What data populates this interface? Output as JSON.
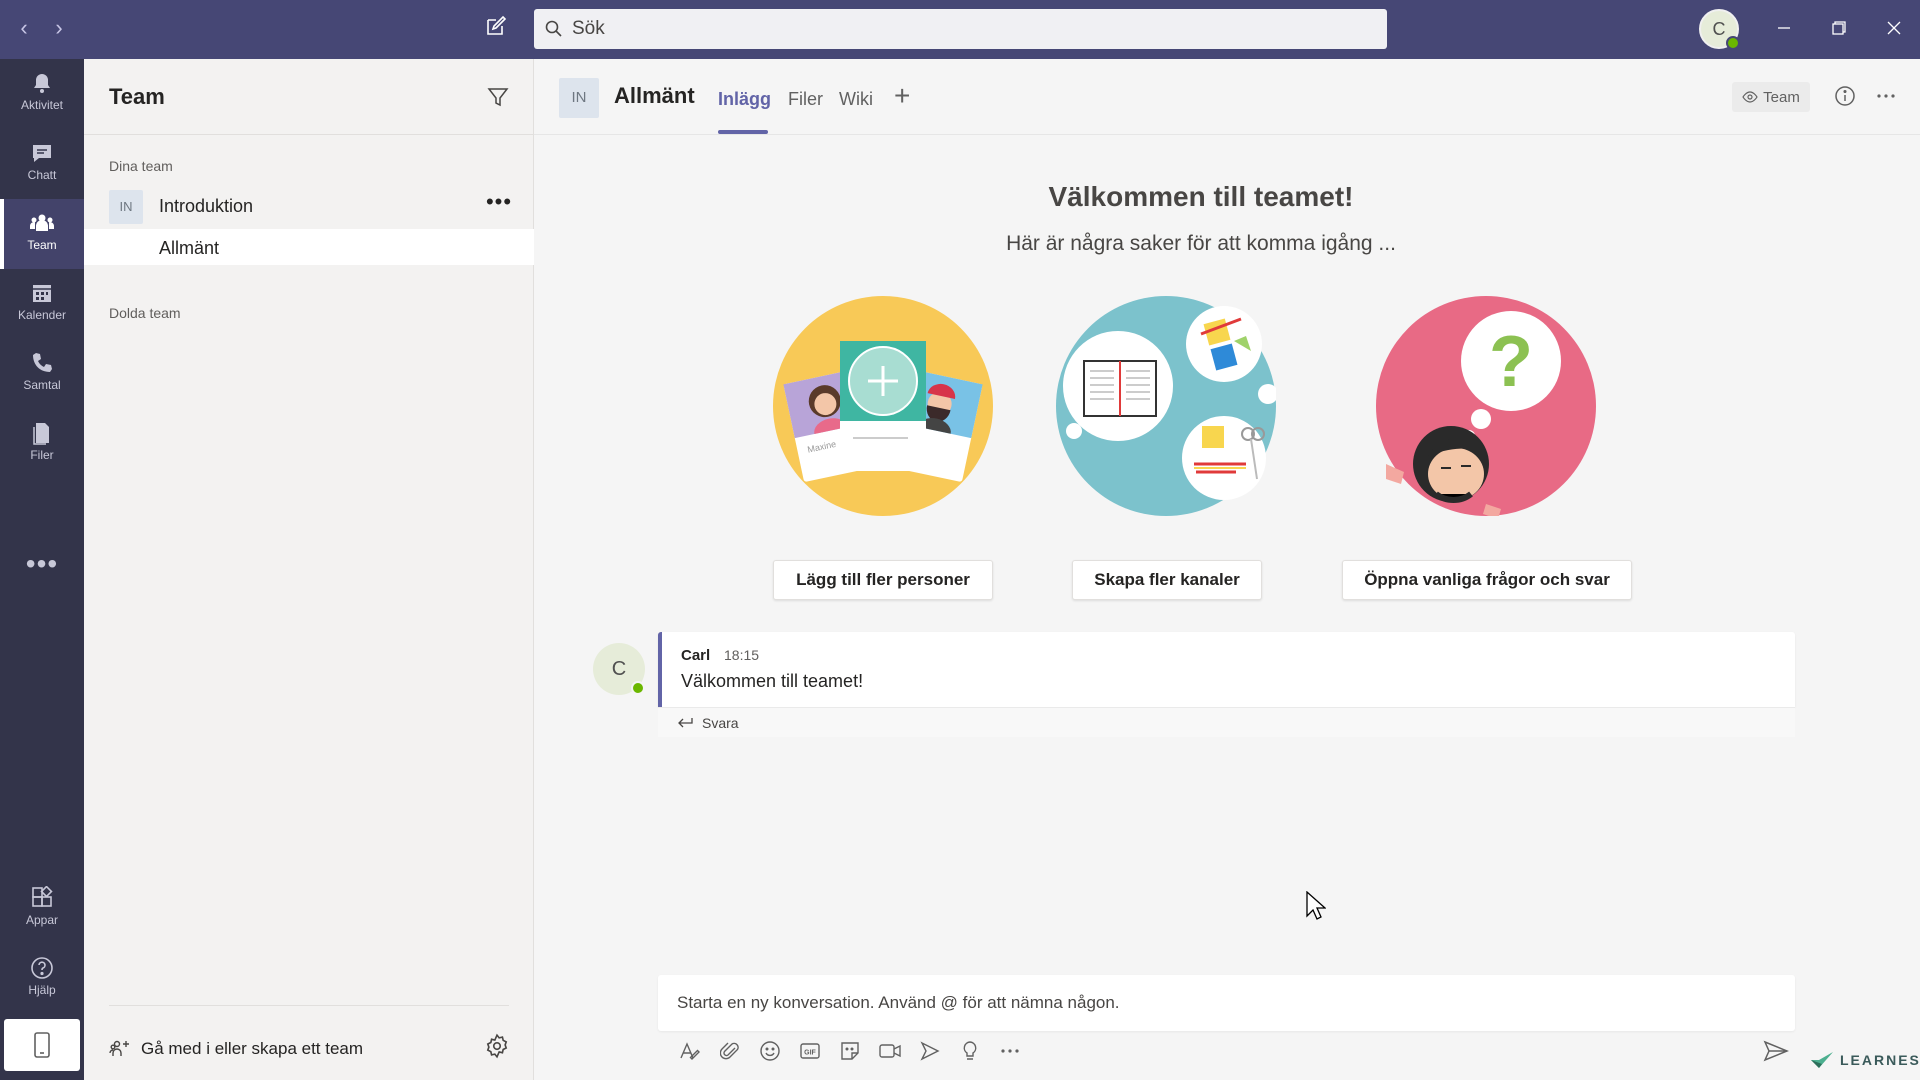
{
  "topbar": {
    "search_placeholder": "Sök",
    "user_initial": "C"
  },
  "rail": {
    "items": [
      {
        "label": "Aktivitet",
        "icon": "bell-icon"
      },
      {
        "label": "Chatt",
        "icon": "chat-icon"
      },
      {
        "label": "Team",
        "icon": "teams-icon",
        "active": true
      },
      {
        "label": "Kalender",
        "icon": "calendar-icon"
      },
      {
        "label": "Samtal",
        "icon": "phone-icon"
      },
      {
        "label": "Filer",
        "icon": "files-icon"
      }
    ],
    "bottom": [
      {
        "label": "Appar",
        "icon": "apps-icon"
      },
      {
        "label": "Hjälp",
        "icon": "help-icon"
      }
    ]
  },
  "team_panel": {
    "title": "Team",
    "your_teams_label": "Dina team",
    "team": {
      "initials": "IN",
      "name": "Introduktion"
    },
    "channel": "Allmänt",
    "hidden_teams_label": "Dolda team",
    "join_label": "Gå med i eller skapa ett team"
  },
  "channel": {
    "initials": "IN",
    "title": "Allmänt",
    "tabs": [
      "Inlägg",
      "Filer",
      "Wiki"
    ],
    "active_tab": "Inlägg",
    "team_button": "Team"
  },
  "welcome": {
    "title": "Välkommen till teamet!",
    "subtitle": "Här är några saker för att komma igång ...",
    "illustration_labels": {
      "left": "Maxine"
    },
    "actions": [
      "Lägg till fler personer",
      "Skapa fler kanaler",
      "Öppna vanliga frågor och svar"
    ]
  },
  "message": {
    "initial": "C",
    "author": "Carl",
    "time": "18:15",
    "text": "Välkommen till teamet!",
    "reply_label": "Svara"
  },
  "compose": {
    "placeholder": "Starta en ny konversation. Använd @ för att nämna någon."
  },
  "watermark": "LEARNESY",
  "colors": {
    "topbar": "#464775",
    "rail": "#33344a",
    "accent": "#6264a7",
    "presence": "#6bb700"
  }
}
